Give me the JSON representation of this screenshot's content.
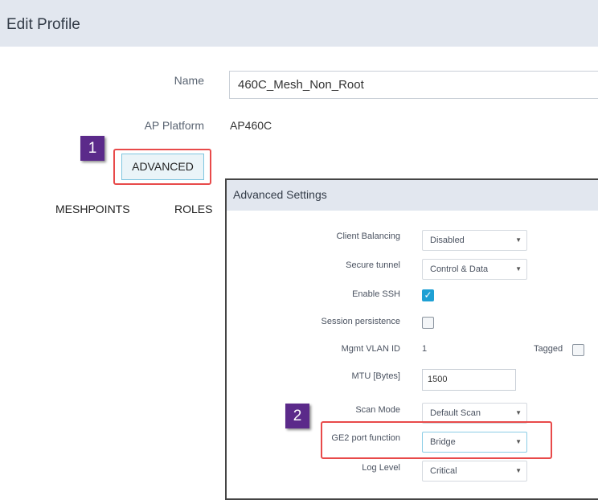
{
  "header": {
    "title": "Edit Profile"
  },
  "form": {
    "name_label": "Name",
    "name_value": "460C_Mesh_Non_Root",
    "platform_label": "AP Platform",
    "platform_value": "AP460C",
    "advanced_label": "ADVANCED"
  },
  "tabs": {
    "meshpoints": "MESHPOINTS",
    "roles": "ROLES"
  },
  "callouts": {
    "first": "1",
    "second": "2",
    "color": "#5b2a8a",
    "highlight": "#e84a4a"
  },
  "panel": {
    "title": "Advanced Settings",
    "client_balancing": {
      "label": "Client Balancing",
      "value": "Disabled"
    },
    "secure_tunnel": {
      "label": "Secure tunnel",
      "value": "Control & Data"
    },
    "enable_ssh": {
      "label": "Enable SSH",
      "checked": true
    },
    "session_persistence": {
      "label": "Session persistence",
      "checked": false
    },
    "mgmt_vlan": {
      "label": "Mgmt VLAN ID",
      "value": "1",
      "tagged_label": "Tagged",
      "tagged_checked": false
    },
    "mtu": {
      "label": "MTU [Bytes]",
      "value": "1500"
    },
    "scan_mode": {
      "label": "Scan Mode",
      "value": "Default Scan"
    },
    "ge2_port": {
      "label": "GE2 port function",
      "value": "Bridge"
    },
    "log_level": {
      "label": "Log Level",
      "value": "Critical"
    }
  },
  "icons": {
    "dropdown": "chevron-down-icon",
    "checked": "checkmark-icon"
  },
  "accent": "#1ea0d4"
}
